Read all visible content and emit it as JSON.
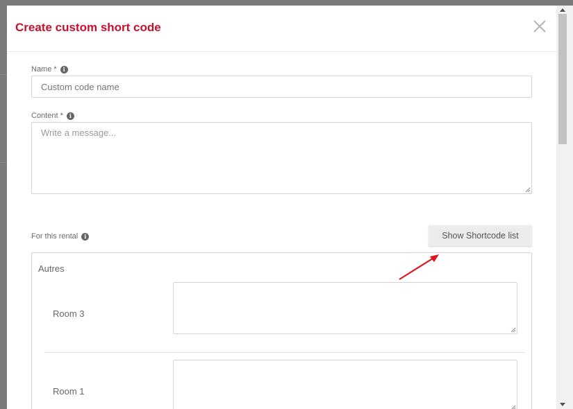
{
  "modal": {
    "title": "Create custom short code"
  },
  "form": {
    "name_label": "Name *",
    "name_placeholder": "Custom code name",
    "content_label": "Content *",
    "content_placeholder": "Write a message...",
    "rental_label": "For this rental",
    "show_shortcode_button": "Show Shortcode list"
  },
  "rental": {
    "group_title": "Autres",
    "rooms": [
      {
        "label": "Room 3",
        "value": ""
      },
      {
        "label": "Room 1",
        "value": ""
      }
    ]
  },
  "colors": {
    "title": "#c8102e",
    "annotation_arrow": "#e0141e"
  },
  "icons": {
    "close": "close-icon",
    "info": "info-icon"
  }
}
